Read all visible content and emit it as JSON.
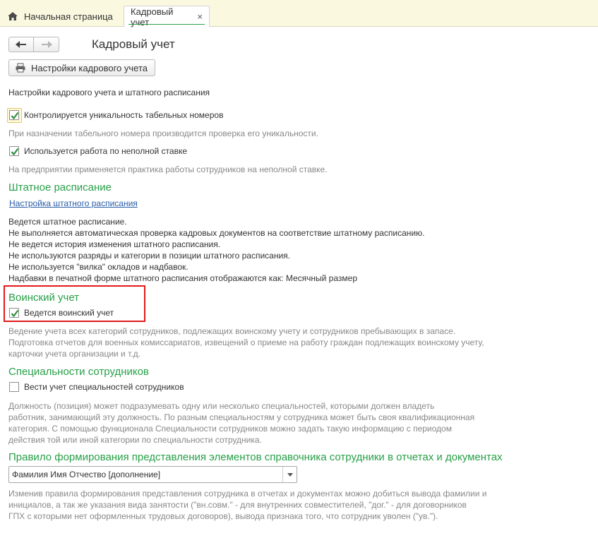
{
  "tabs": [
    {
      "label": "Начальная страница"
    },
    {
      "label": "Кадровый учет",
      "close": "×"
    }
  ],
  "page": {
    "title": "Кадровый учет",
    "settings_button": "Настройки кадрового учета"
  },
  "general": {
    "caption": "Настройки кадрового учета и штатного расписания",
    "check_unique_label": "Контролируется уникальность табельных номеров",
    "check_unique_hint": "При назначении табельного номера производится проверка его уникальности.",
    "check_unique_checked": true,
    "check_parttime_label": "Используется работа по неполной ставке",
    "check_parttime_hint": "На предприятии применяется практика работы сотрудников на неполной ставке.",
    "check_parttime_checked": true
  },
  "staffing": {
    "heading": "Штатное расписание",
    "link": "Настройка штатного расписания",
    "status_lines": [
      "Ведется штатное расписание.",
      "Не выполняется автоматическая проверка кадровых документов на соответствие штатному расписанию.",
      "Не ведется история изменения штатного расписания.",
      "Не используются разряды и категории в позиции штатного расписания.",
      "Не используется \"вилка\" окладов и надбавок.",
      "Надбавки в печатной форме штатного расписания отображаются как: Месячный размер"
    ]
  },
  "military": {
    "heading": "Воинский учет",
    "check_label": "Ведется воинский учет",
    "checked": true,
    "hint_lines": [
      "Ведение учета всех категорий сотрудников, подлежащих воинскому учету и сотрудников пребывающих в запасе.",
      "Подготовка отчетов для военных комиссариатов, извещений о приеме на работу граждан подлежащих воинскому учету,",
      "карточки учета организации и т.д."
    ]
  },
  "specialties": {
    "heading": "Специальности сотрудников",
    "check_label": "Вести учет специальностей сотрудников",
    "checked": false,
    "hint_lines": [
      "Должность (позиция) может подразумевать одну или несколько специальностей, которыми должен владеть",
      "работник, занимающий эту должность. По разным специальностям у сотрудника может быть своя квалификационная",
      "категория. С помощью функционала Специальности сотрудников можно задать такую информацию с периодом",
      "действия той или иной категории по специальности сотрудника."
    ]
  },
  "representation": {
    "heading": "Правило формирования представления элементов справочника сотрудники в отчетах и документах",
    "select_value": "Фамилия Имя Отчество [дополнение]",
    "hint_lines": [
      "Изменив правила формирования представления сотрудника в отчетах и документах можно добиться вывода фамилии и",
      "инициалов, а так же указания вида занятости (\"вн.совм.\" - для внутренних совместителей, \"дог.\" - для договорников",
      "ГПХ с которыми нет оформленных трудовых договоров), вывода признака того, что сотрудник уволен (\"ув.\")."
    ]
  },
  "colors": {
    "accent_green": "#27a048",
    "link_blue": "#2a5ea8",
    "highlight_red": "#e21b1b",
    "tabbar_bg": "#fbf8e0"
  },
  "icons": [
    "home-icon",
    "close-icon",
    "back-arrow-icon",
    "forward-arrow-icon",
    "printer-icon",
    "check-icon",
    "chevron-down-icon"
  ]
}
